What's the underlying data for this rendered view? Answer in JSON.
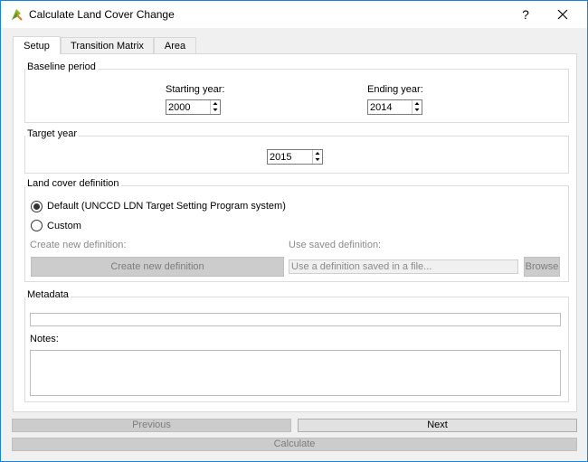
{
  "window": {
    "title": "Calculate Land Cover Change",
    "help_glyph": "?",
    "icon": "qgis-logo-icon"
  },
  "tabs": [
    {
      "label": "Setup",
      "active": true
    },
    {
      "label": "Transition Matrix",
      "active": false
    },
    {
      "label": "Area",
      "active": false
    }
  ],
  "baseline": {
    "title": "Baseline period",
    "start_label": "Starting year:",
    "start_value": "2000",
    "end_label": "Ending year:",
    "end_value": "2014"
  },
  "target": {
    "title": "Target year",
    "value": "2015"
  },
  "landcover": {
    "title": "Land cover definition",
    "option_default": "Default (UNCCD LDN Target Setting Program system)",
    "option_custom": "Custom",
    "selected": "default",
    "create_label": "Create new definition:",
    "create_button": "Create new definition",
    "saved_label": "Use saved definition:",
    "saved_placeholder": "Use a definition saved in a file...",
    "browse_button": "Browse"
  },
  "metadata": {
    "title": "Metadata",
    "notes_label": "Notes:"
  },
  "footer": {
    "previous": "Previous",
    "next": "Next",
    "calculate": "Calculate"
  }
}
